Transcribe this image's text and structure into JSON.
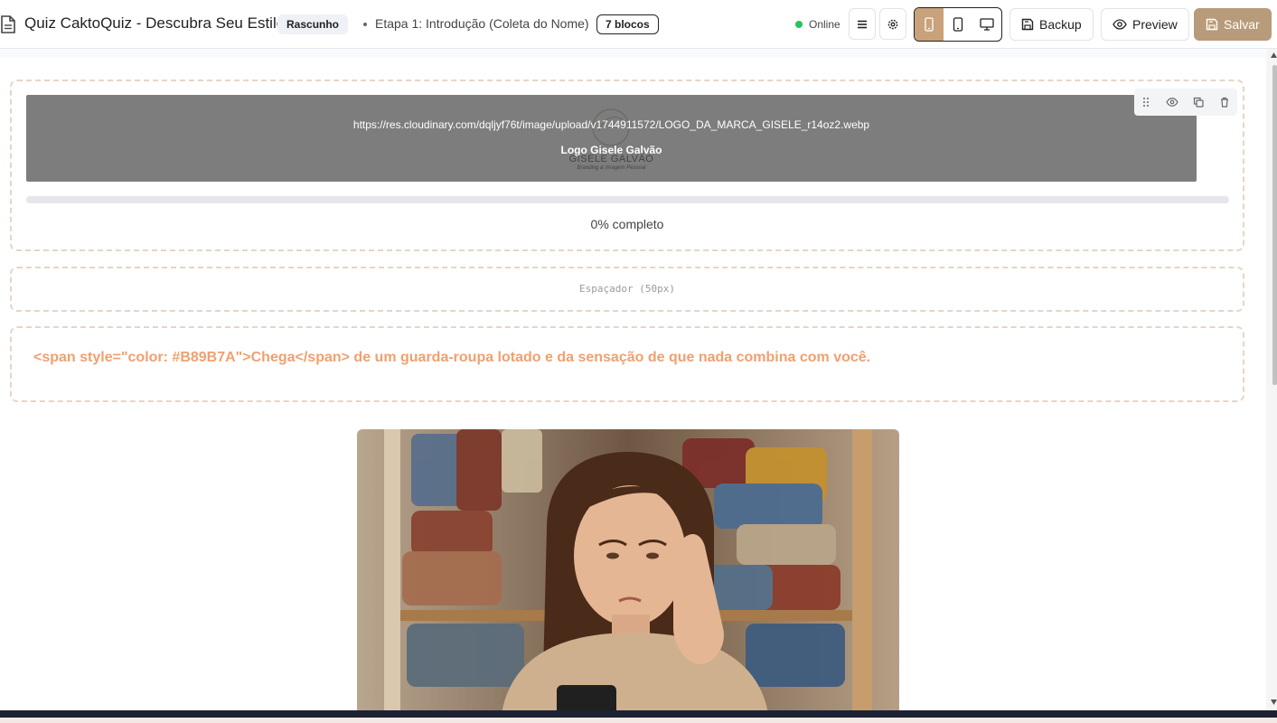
{
  "header": {
    "title": "Quiz CaktoQuiz - Descubra Seu Estilo",
    "status_badge": "Rascunho",
    "stage": "Etapa 1: Introdução (Coleta do Nome)",
    "blocks_count": "7 blocos",
    "connection": "Online",
    "backup_label": "Backup",
    "preview_label": "Preview",
    "save_label": "Salvar",
    "device_active": "mobile"
  },
  "canvas": {
    "header_block": {
      "logo_url": "https://res.cloudinary.com/dqljyf76t/image/upload/v1744911572/LOGO_DA_MARCA_GISELE_r14oz2.webp",
      "logo_alt": "Logo Gisele Galvão",
      "logo_brand": "GISELE GALVÃO",
      "logo_tagline": "Branding & Imagem Pessoal",
      "progress_value": 0,
      "progress_text": "0% completo"
    },
    "spacer_block": {
      "label": "Espaçador (50px)"
    },
    "text_block": {
      "content": "<span style=\"color: #B89B7A\">Chega</span> de um guarda-roupa lotado e da sensação de que nada combina com você."
    }
  },
  "colors": {
    "brand": "#B89B7A",
    "text_accent": "#F0A070",
    "online": "#22C55E"
  }
}
